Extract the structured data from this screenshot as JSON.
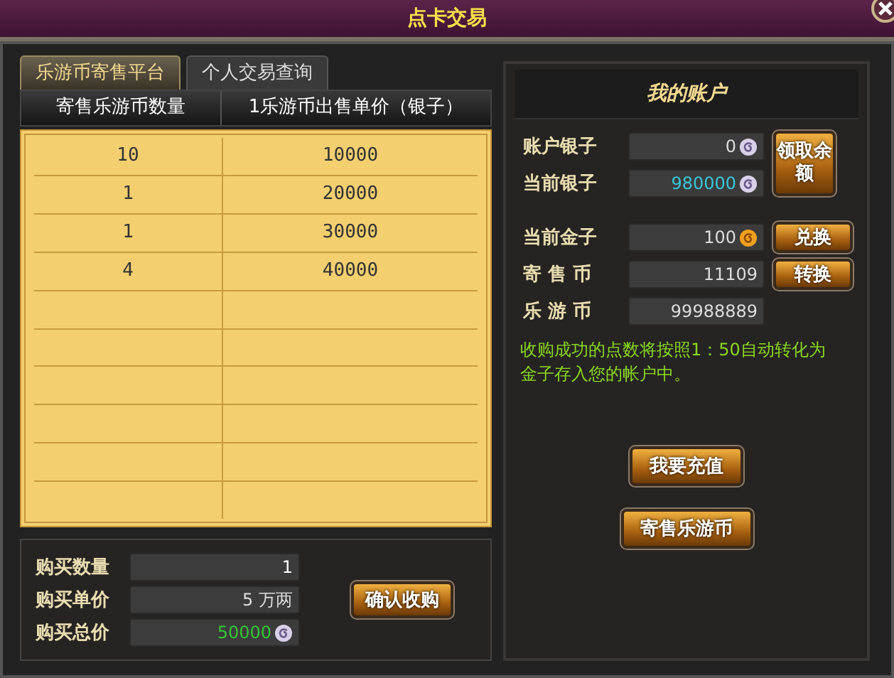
{
  "window": {
    "title": "点卡交易"
  },
  "tabs": [
    {
      "label": "乐游币寄售平台",
      "selected": true
    },
    {
      "label": "个人交易查询",
      "selected": false
    }
  ],
  "table": {
    "columns": [
      "寄售乐游币数量",
      "1乐游币出售单价（银子）"
    ],
    "rows": [
      [
        "10",
        "10000"
      ],
      [
        "1",
        "20000"
      ],
      [
        "1",
        "30000"
      ],
      [
        "4",
        "40000"
      ]
    ]
  },
  "purchase": {
    "fields": [
      {
        "label": "购买数量",
        "value": "1",
        "color": "#ffffff",
        "kind": "plain"
      },
      {
        "label": "购买单价",
        "value": "5 万两",
        "color": "#dddddd",
        "kind": "plain"
      },
      {
        "label": "购买总价",
        "value": "50000",
        "color": "#34c834",
        "kind": "silver"
      }
    ],
    "button": "确认收购"
  },
  "account": {
    "title": "我的账户",
    "fields": [
      {
        "label": "账户银子",
        "value": "0",
        "color": "#dddddd",
        "kind": "silver"
      },
      {
        "label": "当前银子",
        "value": "980000",
        "color": "#38c8d8",
        "kind": "silver"
      },
      {
        "label": "当前金子",
        "value": "100",
        "color": "#dddddd",
        "kind": "gold"
      },
      {
        "label": "寄 售 币",
        "value": "11109",
        "color": "#dddddd",
        "kind": "plain"
      },
      {
        "label": "乐 游 币",
        "value": "99988889",
        "color": "#dddddd",
        "kind": "plain"
      }
    ],
    "side_buttons": [
      {
        "label": "领取余额",
        "kind": "tall"
      },
      {
        "label": "兑换",
        "kind": "small"
      },
      {
        "label": "转换",
        "kind": "small"
      }
    ],
    "note": "收购成功的点数将按照1：50自动转化为金子存入您的帐户中。",
    "buttons": [
      "我要充值",
      "寄售乐游币"
    ]
  }
}
